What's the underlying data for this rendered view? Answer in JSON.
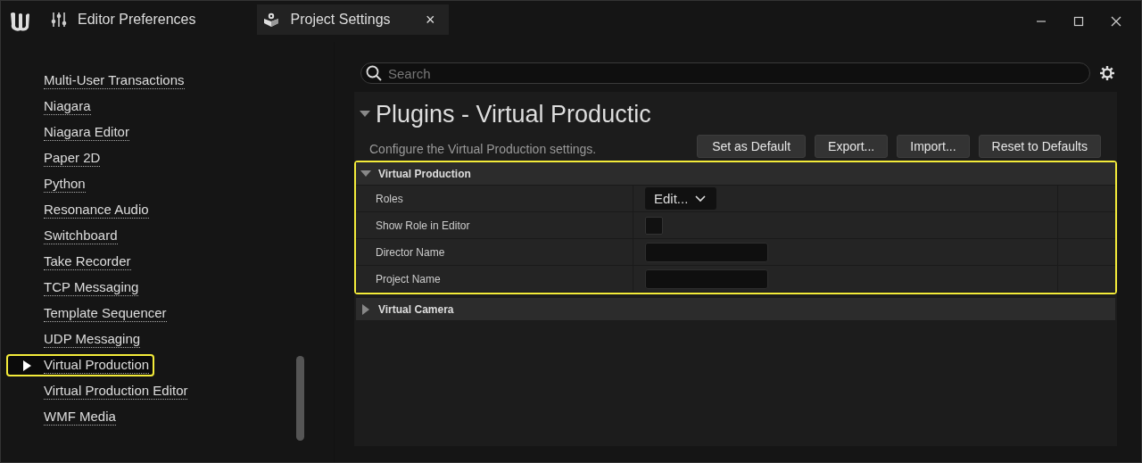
{
  "tabs": [
    {
      "label": "Editor Preferences",
      "selected": false
    },
    {
      "label": "Project Settings",
      "selected": true,
      "close": "×"
    }
  ],
  "sidebar": {
    "items": [
      {
        "label": "Multi-User Transactions",
        "selected": false,
        "highlighted": false
      },
      {
        "label": "Niagara",
        "selected": false,
        "highlighted": false
      },
      {
        "label": "Niagara Editor",
        "selected": false,
        "highlighted": false
      },
      {
        "label": "Paper 2D",
        "selected": false,
        "highlighted": false
      },
      {
        "label": "Python",
        "selected": false,
        "highlighted": false
      },
      {
        "label": "Resonance Audio",
        "selected": false,
        "highlighted": false
      },
      {
        "label": "Switchboard",
        "selected": false,
        "highlighted": false
      },
      {
        "label": "Take Recorder",
        "selected": false,
        "highlighted": false
      },
      {
        "label": "TCP Messaging",
        "selected": false,
        "highlighted": false
      },
      {
        "label": "Template Sequencer",
        "selected": false,
        "highlighted": false
      },
      {
        "label": "UDP Messaging",
        "selected": false,
        "highlighted": false
      },
      {
        "label": "Virtual Production",
        "selected": true,
        "highlighted": true
      },
      {
        "label": "Virtual Production Editor",
        "selected": false,
        "highlighted": false
      },
      {
        "label": "WMF Media",
        "selected": false,
        "highlighted": false
      }
    ]
  },
  "search": {
    "placeholder": "Search"
  },
  "page": {
    "title": "Plugins - Virtual Productic",
    "expanded": true,
    "description": "Configure the Virtual Production settings.",
    "buttons": [
      "Set as Default",
      "Export...",
      "Import...",
      "Reset to Defaults"
    ]
  },
  "sections": [
    {
      "title": "Virtual Production",
      "expanded": true,
      "highlighted": true,
      "rows": [
        {
          "label": "Roles",
          "kind": "dropdown",
          "value": "Edit..."
        },
        {
          "label": "Show Role in Editor",
          "kind": "checkbox",
          "checked": false
        },
        {
          "label": "Director Name",
          "kind": "text"
        },
        {
          "label": "Project Name",
          "kind": "text"
        }
      ]
    },
    {
      "title": "Virtual Camera",
      "expanded": false,
      "highlighted": false
    }
  ]
}
